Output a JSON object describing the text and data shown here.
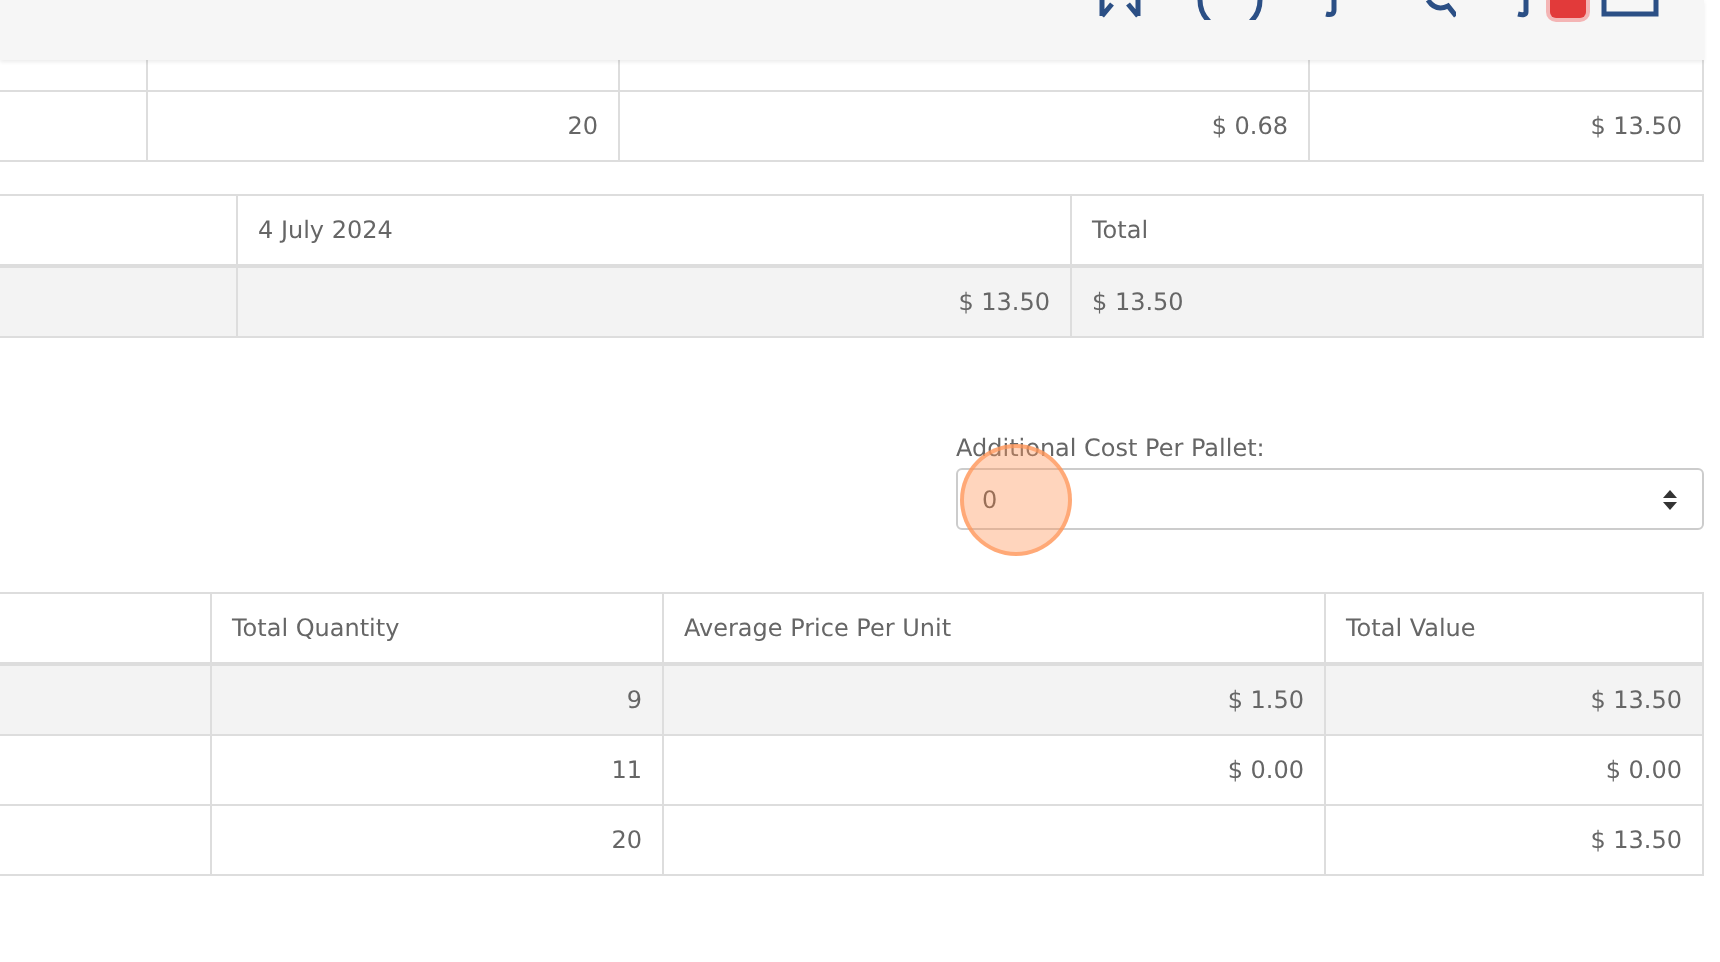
{
  "summary_table": {
    "rows": [
      {
        "cells": [
          "20",
          "$ 0.68",
          "$ 13.50"
        ],
        "highlighted": false
      }
    ]
  },
  "date_table": {
    "columns": [
      "4 July 2024",
      "Total"
    ],
    "rows": [
      {
        "cells": [
          "$ 13.50",
          "$ 13.50"
        ],
        "highlighted": true
      }
    ]
  },
  "additional_cost": {
    "label": "Additional Cost Per Pallet:",
    "value": "0"
  },
  "totals_table": {
    "columns": [
      "Total Quantity",
      "Average Price Per Unit",
      "Total Value"
    ],
    "rows": [
      {
        "cells": [
          "9",
          "$ 1.50",
          "$ 13.50"
        ],
        "highlighted": true
      },
      {
        "cells": [
          "11",
          "$ 0.00",
          "$ 0.00"
        ],
        "highlighted": false
      },
      {
        "cells": [
          "20",
          "",
          "$ 13.50"
        ],
        "highlighted": false
      }
    ]
  }
}
